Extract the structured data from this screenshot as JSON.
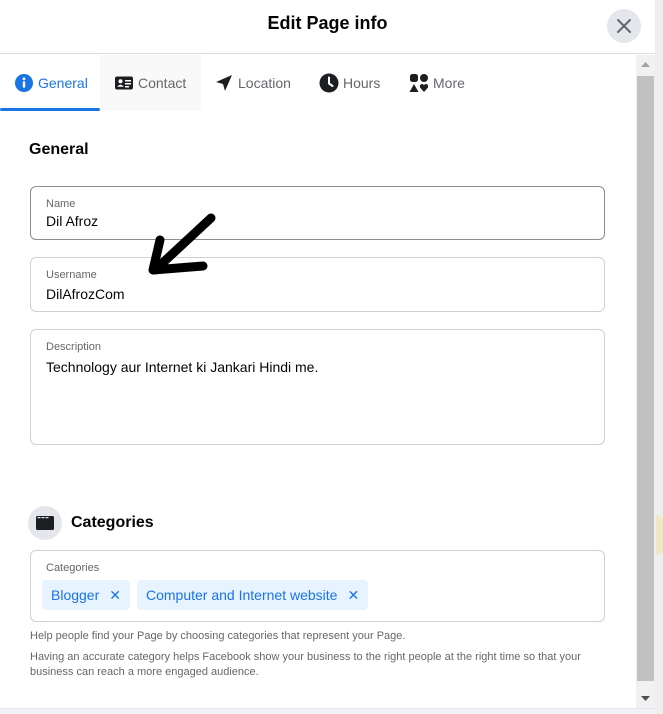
{
  "dialog": {
    "title": "Edit Page info",
    "close_icon": "close-icon"
  },
  "tabs": [
    {
      "label": "General",
      "icon": "info-icon",
      "active": true
    },
    {
      "label": "Contact",
      "icon": "contact-card-icon",
      "active": false
    },
    {
      "label": "Location",
      "icon": "location-arrow-icon",
      "active": false
    },
    {
      "label": "Hours",
      "icon": "clock-icon",
      "active": false
    },
    {
      "label": "More",
      "icon": "shapes-icon",
      "active": false
    }
  ],
  "general": {
    "section_title": "General",
    "name": {
      "label": "Name",
      "value": "Dil Afroz"
    },
    "username": {
      "label": "Username",
      "value": "DilAfrozCom"
    },
    "description": {
      "label": "Description",
      "value": "Technology aur Internet ki Jankari Hindi me."
    }
  },
  "categories": {
    "section_title": "Categories",
    "icon": "folder-icon",
    "field_label": "Categories",
    "chips": [
      {
        "label": "Blogger",
        "remove": "✕"
      },
      {
        "label": "Computer and Internet website",
        "remove": "✕"
      }
    ],
    "help_text_1": "Help people find your Page by choosing categories that represent your Page.",
    "help_text_2": "Having an accurate category helps Facebook show your business to the right people at the right time so that your business can reach a more engaged audience."
  },
  "colors": {
    "accent": "#1b74e4",
    "chip_bg": "#e7f3ff",
    "text_primary": "#050505",
    "text_secondary": "#65676b"
  }
}
